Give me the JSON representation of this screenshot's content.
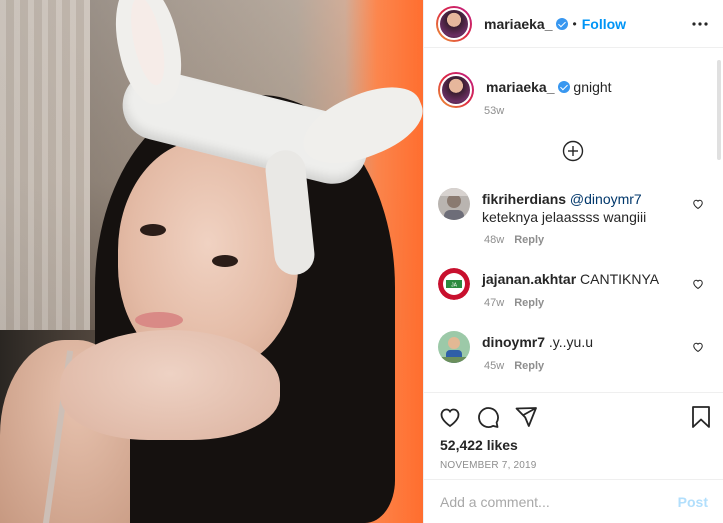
{
  "post": {
    "author": "mariaeka_",
    "follow_label": "Follow",
    "separator": "•",
    "caption_text": "gnight",
    "caption_time": "53w",
    "likes": "52,422 likes",
    "date": "NOVEMBER 7, 2019"
  },
  "comments": [
    {
      "user": "fikriherdians",
      "mention": "@dinoymr7",
      "text": "keteknya jelaassss wangiii",
      "time": "48w",
      "reply": "Reply"
    },
    {
      "user": "jajanan.akhtar",
      "mention": "",
      "text": "CANTIKNYA",
      "time": "47w",
      "reply": "Reply"
    },
    {
      "user": "dinoymr7",
      "mention": "",
      "text": ".y..yu.u",
      "time": "45w",
      "reply": "Reply"
    }
  ],
  "composer": {
    "placeholder": "Add a comment...",
    "post_label": "Post"
  },
  "colors": {
    "follow": "#0095f6",
    "verified": "#3897f0",
    "muted": "#8e8e8e",
    "post_disabled": "#b2dffc"
  },
  "icons": [
    "verified-badge-icon",
    "more-options-icon",
    "load-more-comments-icon",
    "heart-icon",
    "comment-icon",
    "share-icon",
    "bookmark-icon",
    "comment-like-icon"
  ]
}
